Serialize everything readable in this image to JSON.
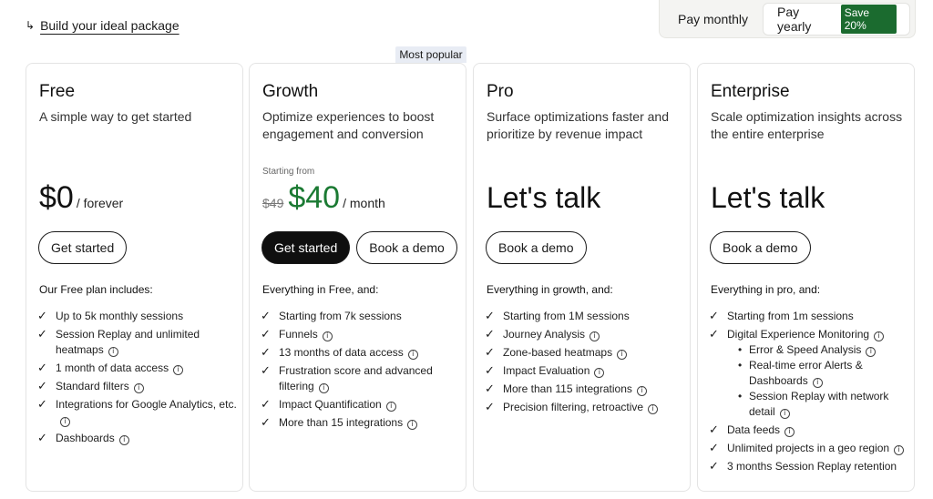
{
  "build_link": {
    "arrow": "↳",
    "label": "Build your ideal package"
  },
  "billing": {
    "monthly": "Pay monthly",
    "yearly": "Pay yearly",
    "save": "Save 20%"
  },
  "popular_tag": "Most popular",
  "plans": {
    "free": {
      "name": "Free",
      "desc": "A simple way to get started",
      "price": "$0",
      "unit": "/ forever",
      "cta": "Get started",
      "includes": "Our Free plan includes:",
      "features": [
        "Up to 5k monthly sessions",
        "Session Replay and unlimited heatmaps",
        "1 month of data access",
        "Standard filters",
        "Integrations for Google Analytics, etc.",
        "Dashboards"
      ]
    },
    "growth": {
      "name": "Growth",
      "desc": "Optimize experiences to boost engagement and conversion",
      "starting": "Starting from",
      "old_price": "$49",
      "price": "$40",
      "unit": "/ month",
      "cta": "Get started",
      "cta2": "Book a demo",
      "includes": "Everything in Free, and:",
      "features": [
        "Starting from 7k sessions",
        "Funnels",
        "13 months of data access",
        "Frustration score and advanced filtering",
        "Impact Quantification",
        "More than 15 integrations"
      ]
    },
    "pro": {
      "name": "Pro",
      "desc": "Surface optimizations faster and prioritize by revenue impact",
      "price": "Let's talk",
      "cta": "Book a demo",
      "includes": "Everything in growth, and:",
      "features": [
        "Starting from 1M sessions",
        "Journey Analysis",
        "Zone-based heatmaps",
        "Impact Evaluation",
        "More than 115 integrations",
        "Precision filtering, retroactive"
      ]
    },
    "enterprise": {
      "name": "Enterprise",
      "desc": "Scale optimization insights across the entire enterprise",
      "price": "Let's talk",
      "cta": "Book a demo",
      "includes": "Everything in pro, and:",
      "features": [
        "Starting from 1m sessions",
        "Digital Experience Monitoring",
        "Data feeds",
        "Unlimited projects in a geo region",
        "3 months Session Replay retention"
      ],
      "sub_features": [
        "Error & Speed Analysis",
        "Real-time error Alerts & Dashboards",
        "Session Replay with network detail"
      ]
    }
  },
  "icons": {
    "check": "✓",
    "info": "i"
  },
  "colors": {
    "green_price": "#1b7a33",
    "save_badge": "#1b6b2f",
    "popular_bg": "#e8ecf4"
  }
}
